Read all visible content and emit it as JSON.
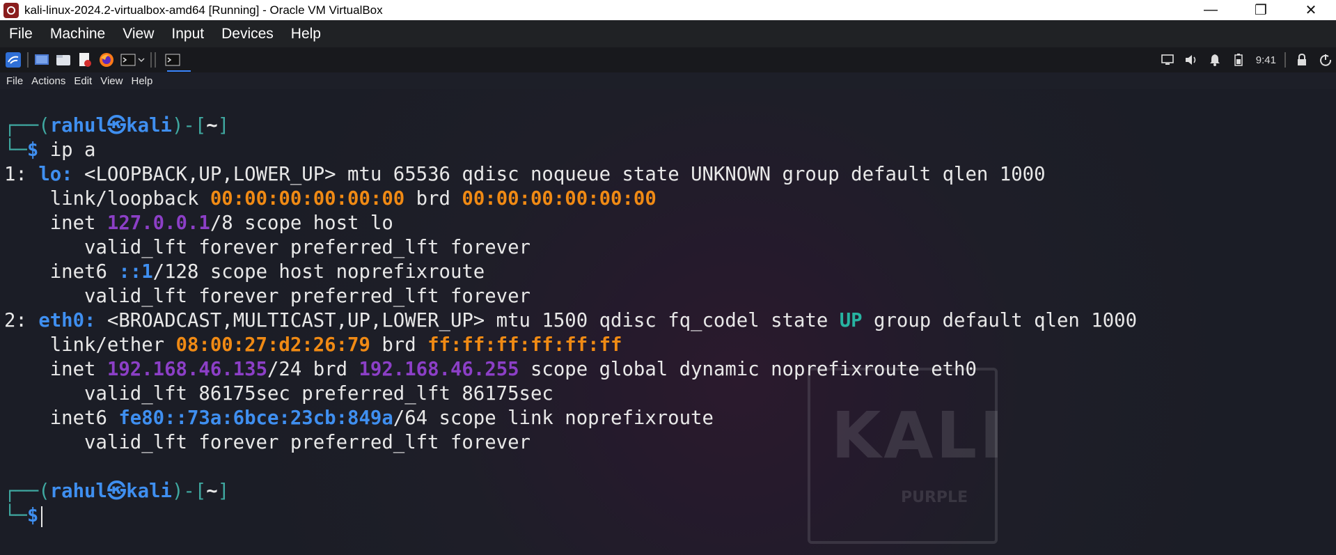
{
  "window": {
    "title": "kali-linux-2024.2-virtualbox-amd64 [Running] - Oracle VM VirtualBox",
    "minimize": "—",
    "restore": "❐",
    "close": "✕"
  },
  "vbox_menu": [
    "File",
    "Machine",
    "View",
    "Input",
    "Devices",
    "Help"
  ],
  "panel": {
    "clock": "9:41",
    "launchers": [
      "kali-menu-icon",
      "desktop-icon",
      "file-manager-icon",
      "text-editor-icon",
      "firefox-icon",
      "terminal-icon"
    ]
  },
  "terminal_menu": [
    "File",
    "Actions",
    "Edit",
    "View",
    "Help"
  ],
  "prompt": {
    "corner_top": "┌──(",
    "user": "rahul",
    "at": "㉿",
    "host": "kali",
    "close": ")-[",
    "dir": "~",
    "end": "]",
    "corner_bottom": "└─",
    "dollar": "$"
  },
  "commands": {
    "first": " ip a"
  },
  "output": {
    "l1_idx": "1: ",
    "l1_if": "lo:",
    "l1_rest": " <LOOPBACK,UP,LOWER_UP> mtu 65536 qdisc noqueue state UNKNOWN group default qlen 1000",
    "l2_a": "    link/loopback ",
    "l2_mac": "00:00:00:00:00:00",
    "l2_b": " brd ",
    "l2_brd": "00:00:00:00:00:00",
    "l3_a": "    inet ",
    "l3_ip": "127.0.0.1",
    "l3_b": "/8 scope host lo",
    "l4": "       valid_lft forever preferred_lft forever",
    "l5_a": "    inet6 ",
    "l5_ip": "::1",
    "l5_b": "/128 scope host noprefixroute",
    "l6": "       valid_lft forever preferred_lft forever",
    "l7_idx": "2: ",
    "l7_if": "eth0:",
    "l7_a": " <BROADCAST,MULTICAST,UP,LOWER_UP> mtu 1500 qdisc fq_codel state ",
    "l7_state": "UP",
    "l7_b": " group default qlen 1000",
    "l8_a": "    link/ether ",
    "l8_mac": "08:00:27:d2:26:79",
    "l8_b": " brd ",
    "l8_brd": "ff:ff:ff:ff:ff:ff",
    "l9_a": "    inet ",
    "l9_ip": "192.168.46.135",
    "l9_b": "/24 brd ",
    "l9_brd": "192.168.46.255",
    "l9_c": " scope global dynamic noprefixroute eth0",
    "l10": "       valid_lft 86175sec preferred_lft 86175sec",
    "l11_a": "    inet6 ",
    "l11_ip": "fe80::73a:6bce:23cb:849a",
    "l11_b": "/64 scope link noprefixroute",
    "l12": "       valid_lft forever preferred_lft forever"
  },
  "wallpaper": {
    "logo_text": "KALI",
    "logo_sub": "PURPLE"
  }
}
